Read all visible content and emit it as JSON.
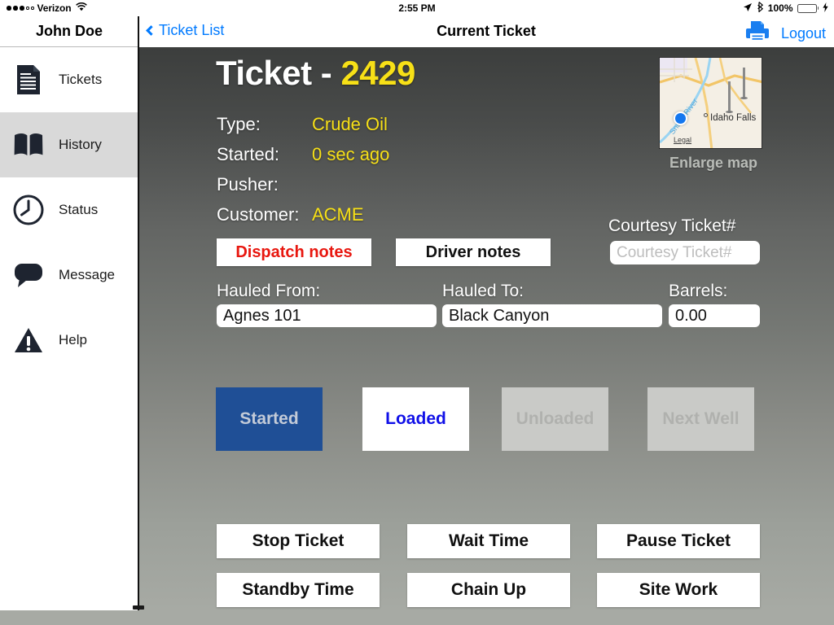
{
  "statusbar": {
    "carrier": "Verizon",
    "signal_dots_filled": 3,
    "signal_dots_total": 5,
    "wifi_icon": "wifi-icon",
    "time": "2:55 PM",
    "location_icon": "location-arrow-icon",
    "bluetooth_icon": "bluetooth-icon",
    "battery_percent": "100%",
    "charging_icon": "lightning-bolt-icon",
    "battery_color": "#4cd54c"
  },
  "sidebar": {
    "user_name": "John Doe",
    "items": [
      {
        "label": "Tickets",
        "icon": "document-icon",
        "active": false
      },
      {
        "label": "History",
        "icon": "book-icon",
        "active": true
      },
      {
        "label": "Status",
        "icon": "clock-icon",
        "active": false
      },
      {
        "label": "Message",
        "icon": "speech-bubble-icon",
        "active": false
      },
      {
        "label": "Help",
        "icon": "warning-triangle-icon",
        "active": false
      }
    ],
    "active_background": "#d9d9d9"
  },
  "navbar": {
    "back_label": "Ticket List",
    "back_icon": "chevron-left-icon",
    "title": "Current Ticket",
    "print_icon": "printer-icon",
    "logout_label": "Logout",
    "accent_color": "#007aff"
  },
  "ticket": {
    "heading_label": "Ticket - ",
    "heading_number": "2429",
    "number_color": "#f7e017",
    "fields": [
      {
        "key": "Type:",
        "value": "Crude Oil"
      },
      {
        "key": "Started:",
        "value": "0 sec ago"
      },
      {
        "key": "Pusher:",
        "value": ""
      },
      {
        "key": "Customer:",
        "value": "ACME"
      }
    ]
  },
  "map": {
    "city_label": "Idaho Falls",
    "river_label": "Snake River",
    "legal_label": "Legal",
    "enlarge_label": "Enlarge map",
    "pin_red_color": "#e0302a",
    "pin_green_color": "#3fbb3f",
    "current_location_color": "#1477ef"
  },
  "notes": {
    "dispatch_label": "Dispatch notes",
    "dispatch_color": "#e8170f",
    "driver_label": "Driver notes",
    "driver_color": "#111111"
  },
  "courtesy": {
    "label": "Courtesy Ticket#",
    "placeholder": "Courtesy Ticket#",
    "value": ""
  },
  "haul": {
    "from_label": "Hauled From:",
    "from_value": "Agnes 101",
    "to_label": "Hauled To:",
    "to_value": "Black Canyon",
    "barrels_label": "Barrels:",
    "barrels_value": "0.00"
  },
  "status_buttons": [
    {
      "label": "Started",
      "state": "selected",
      "bg": "#1f4f96",
      "fg": "#c3cbd8"
    },
    {
      "label": "Loaded",
      "state": "enabled",
      "bg": "#ffffff",
      "fg": "#1010e8"
    },
    {
      "label": "Unloaded",
      "state": "disabled",
      "bg": "#c9cac7",
      "fg": "#b0b1ae"
    },
    {
      "label": "Next Well",
      "state": "disabled",
      "bg": "#c9cac7",
      "fg": "#b0b1ae"
    }
  ],
  "action_buttons": [
    {
      "label": "Stop Ticket"
    },
    {
      "label": "Wait Time"
    },
    {
      "label": "Pause Ticket"
    },
    {
      "label": "Standby Time"
    },
    {
      "label": "Chain Up"
    },
    {
      "label": "Site Work"
    }
  ]
}
